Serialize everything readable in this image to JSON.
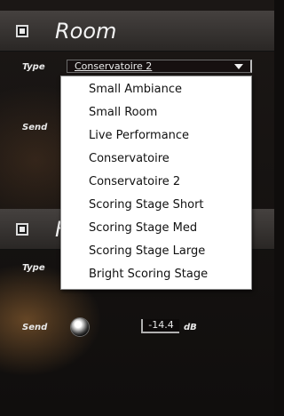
{
  "room": {
    "title": "Room",
    "type_label": "Type",
    "type_value": "Conservatoire 2",
    "send_label": "Send"
  },
  "second": {
    "title_partial": "F",
    "type_label": "Type",
    "send_label": "Send",
    "send_value": "-14.4",
    "send_unit": "dB"
  },
  "dropdown": {
    "items": [
      "Small Ambiance",
      "Small Room",
      "Live Performance",
      "Conservatoire",
      "Conservatoire 2",
      "Scoring Stage Short",
      "Scoring Stage Med",
      "Scoring Stage Large",
      "Bright Scoring Stage"
    ]
  }
}
